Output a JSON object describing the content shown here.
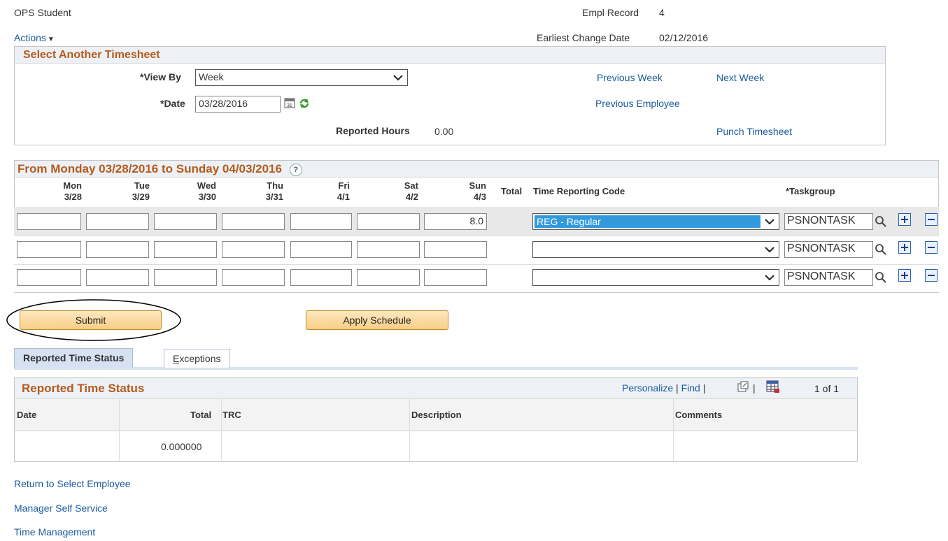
{
  "header": {
    "employee_name": "OPS Student",
    "empl_record_label": "Empl Record",
    "empl_record_value": "4",
    "actions_label": "Actions",
    "earliest_change_label": "Earliest Change Date",
    "earliest_change_value": "02/12/2016"
  },
  "select_timesheet": {
    "title": "Select Another Timesheet",
    "view_by_label": "*View By",
    "view_by_value": "Week",
    "date_label": "*Date",
    "date_value": "03/28/2016",
    "reported_hours_label": "Reported Hours",
    "reported_hours_value": "0.00",
    "previous_week": "Previous Week",
    "next_week": "Next Week",
    "previous_employee": "Previous Employee",
    "punch_timesheet": "Punch Timesheet"
  },
  "timesheet": {
    "title": "From Monday 03/28/2016 to Sunday 04/03/2016",
    "help_icon": "?",
    "days": [
      {
        "day": "Mon",
        "date": "3/28"
      },
      {
        "day": "Tue",
        "date": "3/29"
      },
      {
        "day": "Wed",
        "date": "3/30"
      },
      {
        "day": "Thu",
        "date": "3/31"
      },
      {
        "day": "Fri",
        "date": "4/1"
      },
      {
        "day": "Sat",
        "date": "4/2"
      },
      {
        "day": "Sun",
        "date": "4/3"
      }
    ],
    "total_label": "Total",
    "trc_label": "Time Reporting Code",
    "taskgroup_label": "*Taskgroup",
    "rows": [
      {
        "hours": [
          "",
          "",
          "",
          "",
          "",
          "",
          "8.0"
        ],
        "trc": "REG - Regular",
        "taskgroup": "PSNONTASK"
      },
      {
        "hours": [
          "",
          "",
          "",
          "",
          "",
          "",
          ""
        ],
        "trc": "",
        "taskgroup": "PSNONTASK"
      },
      {
        "hours": [
          "",
          "",
          "",
          "",
          "",
          "",
          ""
        ],
        "trc": "",
        "taskgroup": "PSNONTASK"
      }
    ]
  },
  "buttons": {
    "submit": "Submit",
    "apply_schedule": "Apply Schedule"
  },
  "tabs": {
    "reported_time_status": "Reported Time Status",
    "exceptions_underlined": "E",
    "exceptions_rest": "xceptions"
  },
  "status_grid": {
    "title": "Reported Time Status",
    "personalize": "Personalize",
    "find": "Find",
    "sep": "|",
    "count": "1 of 1",
    "columns": {
      "date": "Date",
      "total": "Total",
      "trc": "TRC",
      "description": "Description",
      "comments": "Comments"
    },
    "row": {
      "date": "",
      "total": "0.000000",
      "trc": "",
      "description": "",
      "comments": ""
    }
  },
  "footer_links": {
    "return": "Return to Select Employee",
    "manager": "Manager Self Service",
    "time_mgmt": "Time Management"
  },
  "colors": {
    "accent_header": "#b55a1a",
    "link": "#1a5b9e",
    "selected_trc": "#3399dd"
  }
}
